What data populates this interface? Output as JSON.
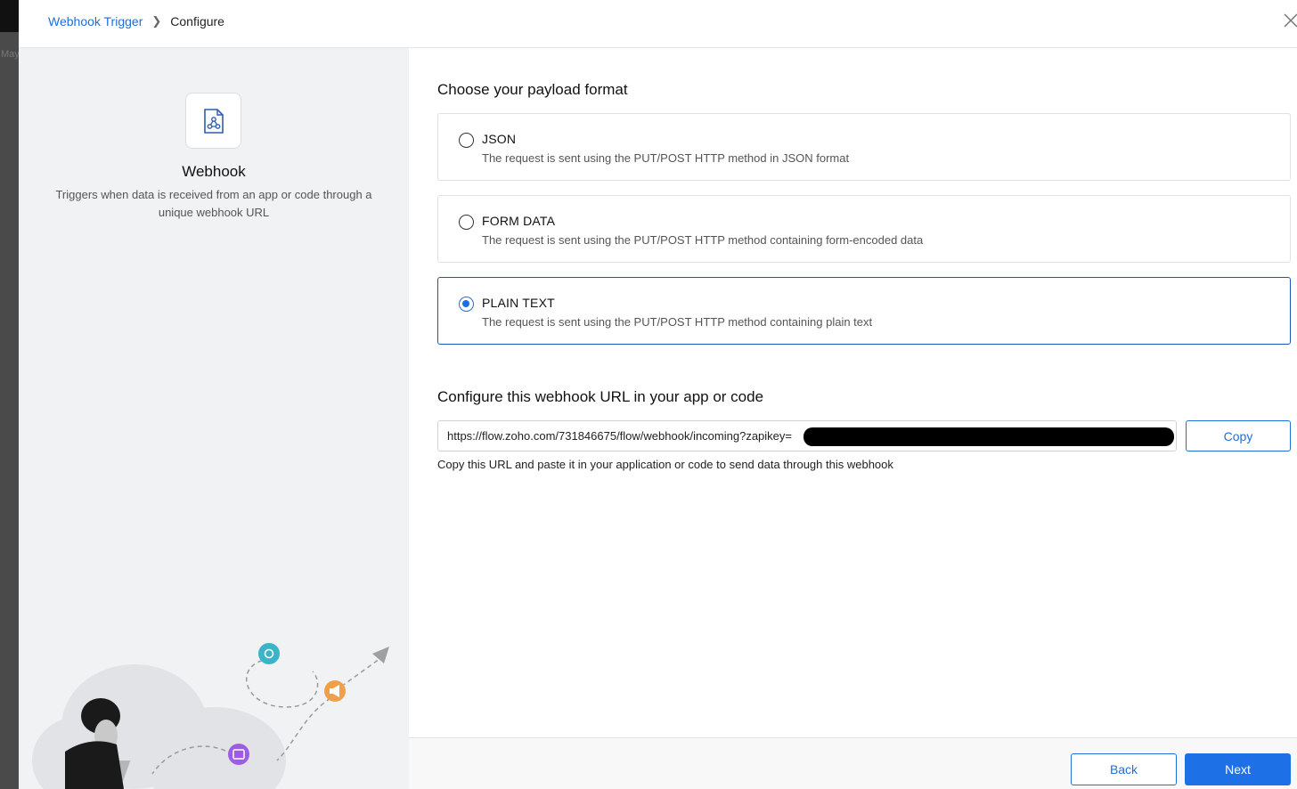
{
  "backdrop": {
    "hint_text": "May"
  },
  "breadcrumb": {
    "parent": "Webhook Trigger",
    "current": "Configure"
  },
  "app": {
    "name": "Webhook",
    "description": "Triggers when data is received from an app or code through a unique webhook URL",
    "icon": "webhook-icon"
  },
  "payload": {
    "title": "Choose your payload format",
    "selected": "PLAIN TEXT",
    "options": [
      {
        "label": "JSON",
        "description": "The request is sent using the PUT/POST HTTP method in JSON format"
      },
      {
        "label": "FORM DATA",
        "description": "The request is sent using the PUT/POST HTTP method containing form-encoded data"
      },
      {
        "label": "PLAIN TEXT",
        "description": "The request is sent using the PUT/POST HTTP method containing plain text"
      }
    ]
  },
  "webhook": {
    "title": "Configure this webhook URL in your app or code",
    "url": "https://flow.zoho.com/731846675/flow/webhook/incoming?zapikey=",
    "copy_label": "Copy",
    "help": "Copy this URL and paste it in your application or code to send data through this webhook"
  },
  "footer": {
    "back_label": "Back",
    "next_label": "Next"
  },
  "colors": {
    "accent": "#1e70e6",
    "link": "#1f6fd6",
    "left_panel": "#f1f2f4",
    "teal": "#3ab5c8",
    "orange": "#f0a04b",
    "purple": "#9b5de5"
  }
}
